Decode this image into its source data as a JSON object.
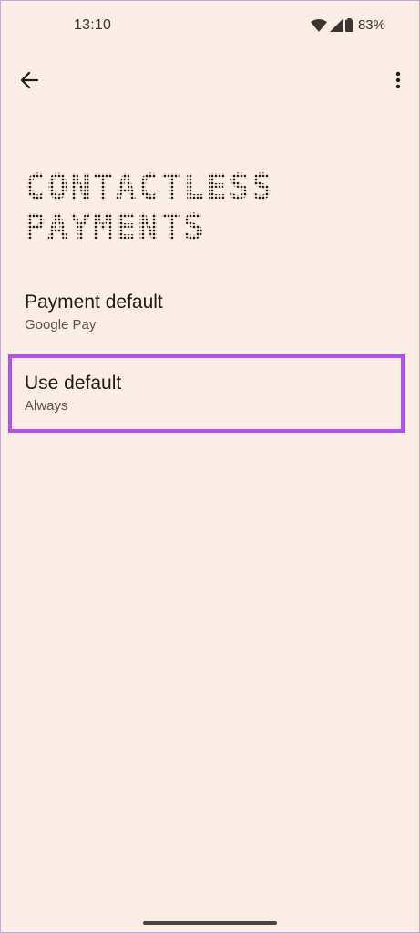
{
  "status_bar": {
    "time": "13:10",
    "battery_percent": "83%",
    "icons": [
      "wifi-icon",
      "signal-icon",
      "battery-icon"
    ]
  },
  "app_bar": {
    "back_icon": "arrow-back-icon",
    "menu_icon": "more-vert-icon"
  },
  "page": {
    "title_line1": "CONTACTLESS",
    "title_line2": "PAYMENTS"
  },
  "preferences": [
    {
      "title": "Payment default",
      "summary": "Google Pay"
    },
    {
      "title": "Use default",
      "summary": "Always",
      "highlighted": true
    }
  ],
  "colors": {
    "background": "#f9ede6",
    "highlight": "#b24ff0",
    "text_primary": "#1f1b18",
    "text_secondary": "#5a524d"
  }
}
